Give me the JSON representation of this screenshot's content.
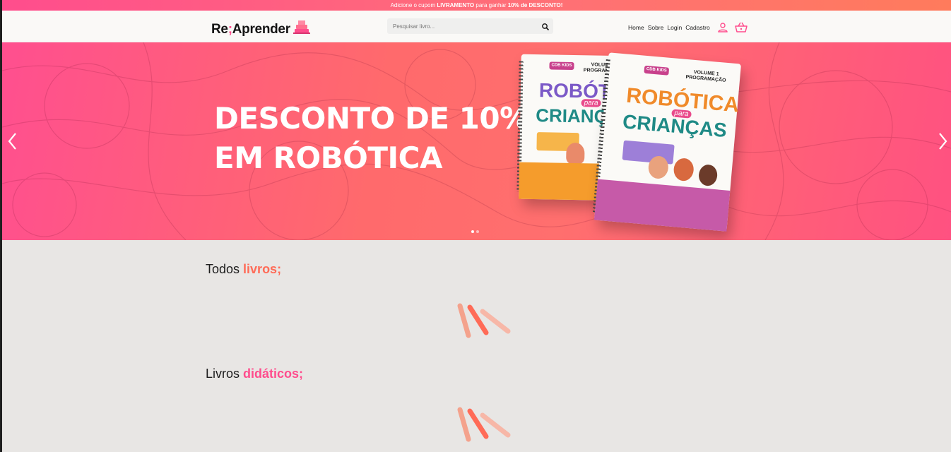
{
  "promo": {
    "prefix": "Adicione o cupom ",
    "coupon": "LIVRAMENTO",
    "middle": " para ganhar ",
    "discount": "10% de DESCONTO!"
  },
  "header": {
    "logo_part1": "Re",
    "logo_semicolon": ";",
    "logo_part2": "Aprender",
    "search_placeholder": "Pesquisar livro...",
    "nav": [
      "Home",
      "Sobre",
      "Login",
      "Cadastro"
    ]
  },
  "hero": {
    "line1": "DESCONTO DE 10%",
    "line2": "EM ROBÓTICA",
    "slide_count": 2,
    "active_slide": 1,
    "book_back": {
      "brand": "CDB KIDS",
      "volume": "VOLUME 2",
      "subject": "PROGRAMAÇÃO",
      "title_top": "ROBÓTICA",
      "title_mid": "para",
      "title_bottom": "CRIANÇAS"
    },
    "book_front": {
      "brand": "CDB KIDS",
      "volume": "VOLUME 1",
      "subject": "PROGRAMAÇÃO",
      "title_top": "ROBÓTICA",
      "title_mid": "para",
      "title_bottom": "CRIANÇAS"
    }
  },
  "sections": [
    {
      "title_plain": "Todos ",
      "title_accent": "livros;"
    },
    {
      "title_plain": "Livros ",
      "title_accent": "didáticos;"
    }
  ],
  "colors": {
    "pink": "#ff4d8d",
    "coral": "#ff6b57",
    "background": "#e8e6e4"
  }
}
